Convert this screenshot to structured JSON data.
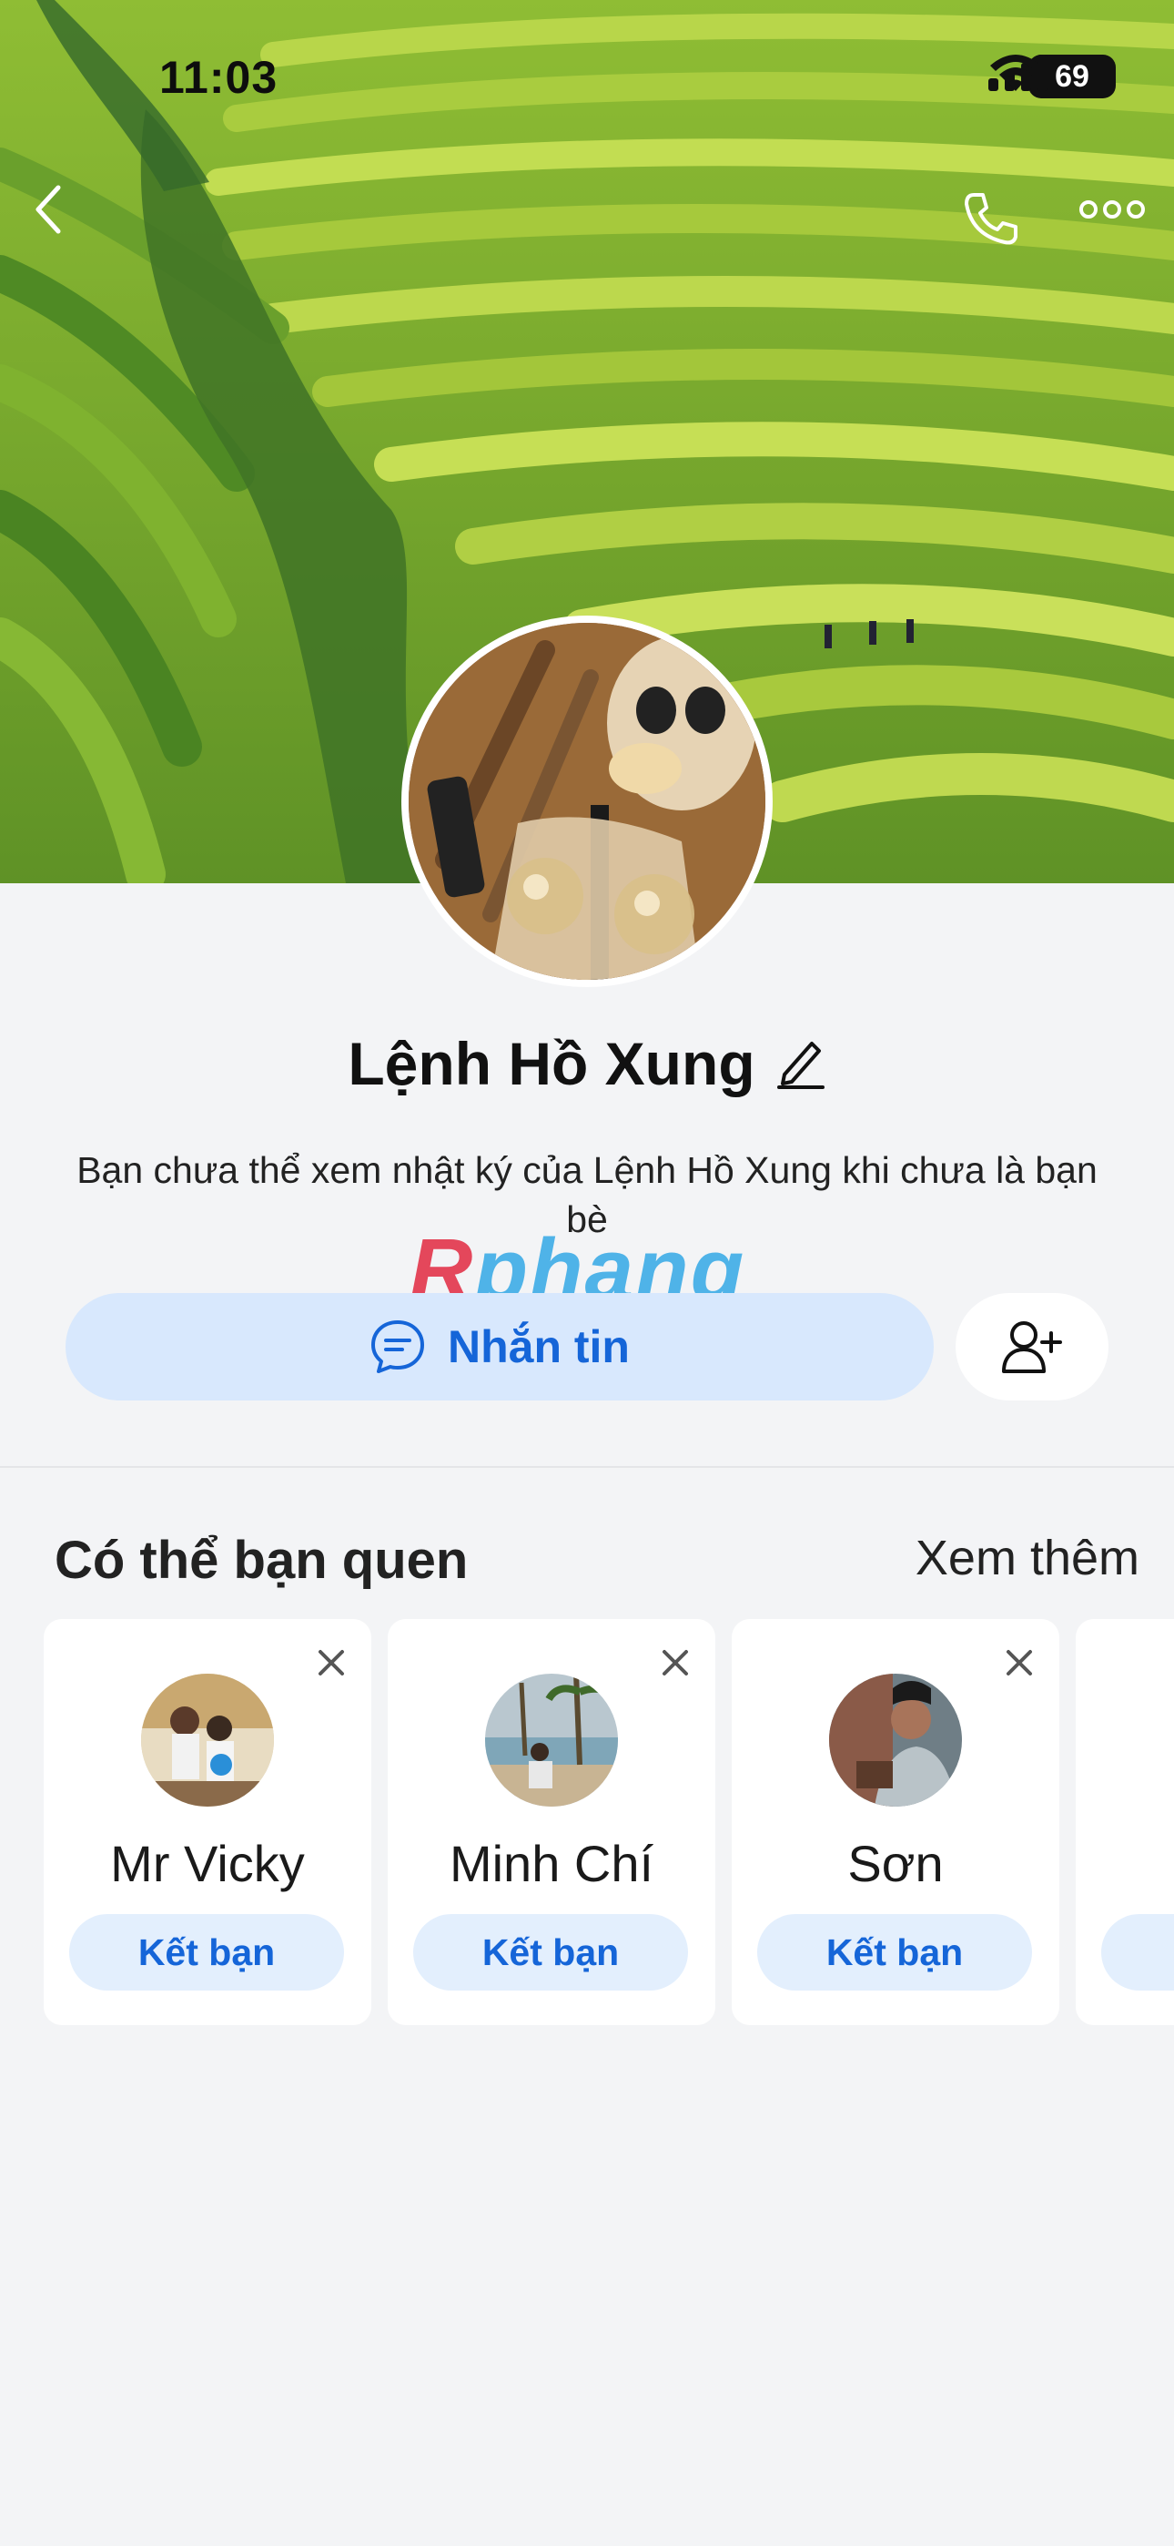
{
  "status_bar": {
    "time": "11:03",
    "battery": "69"
  },
  "profile": {
    "name": "Lệnh Hồ Xung",
    "notice": "Bạn chưa thể xem nhật ký của Lệnh Hồ Xung khi chưa là bạn bè"
  },
  "watermark": {
    "first": "R",
    "rest": "phang"
  },
  "actions": {
    "message_label": "Nhắn tin"
  },
  "suggestions": {
    "title": "Có thể bạn quen",
    "see_more": "Xem thêm",
    "add_label": "Kết bạn",
    "people": [
      {
        "name": "Mr Vicky"
      },
      {
        "name": "Minh Chí"
      },
      {
        "name": "Sơn"
      }
    ]
  },
  "colors": {
    "accent": "#1565d8",
    "accent_bg": "#d8e8fd",
    "page_bg": "#f3f4f6"
  }
}
